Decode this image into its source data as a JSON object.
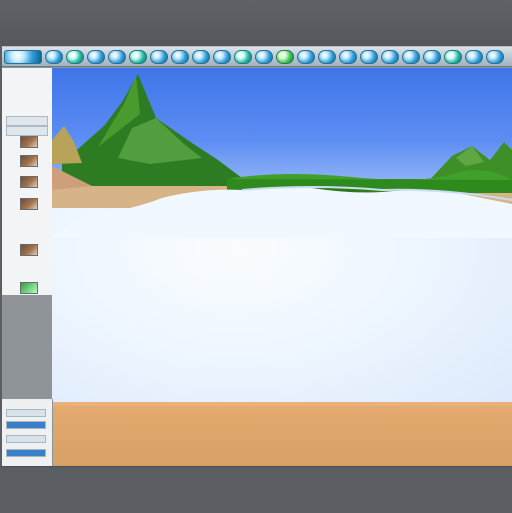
{
  "app": {
    "theme": {
      "window": "#8f9499",
      "toolbar": "#c8d6e0",
      "sky": "#3e75e8"
    }
  },
  "toolbar": {
    "buttons": [
      {
        "name": "dots-menu-icon"
      },
      {
        "name": "globe-icon"
      },
      {
        "name": "globe-icon"
      },
      {
        "name": "globe-icon"
      },
      {
        "name": "globe-icon"
      },
      {
        "name": "globe-icon"
      },
      {
        "name": "globe-icon"
      },
      {
        "name": "globe-icon"
      },
      {
        "name": "globe-icon"
      },
      {
        "name": "globe-icon"
      },
      {
        "name": "globe-icon"
      },
      {
        "name": "globe-icon"
      },
      {
        "name": "globe-icon"
      },
      {
        "name": "globe-icon"
      },
      {
        "name": "globe-icon"
      },
      {
        "name": "globe-icon"
      },
      {
        "name": "globe-icon"
      },
      {
        "name": "globe-icon"
      },
      {
        "name": "globe-icon"
      },
      {
        "name": "globe-icon"
      },
      {
        "name": "globe-icon"
      },
      {
        "name": "globe-icon"
      },
      {
        "name": "globe-icon"
      }
    ]
  },
  "sidebar": {
    "items": [
      {
        "name": "layer-thumbnail"
      },
      {
        "name": "layer-thumbnail"
      },
      {
        "name": "layer-thumbnail"
      },
      {
        "name": "layer-thumbnail"
      },
      {
        "name": "layer-thumbnail"
      },
      {
        "name": "layer-thumbnail"
      }
    ]
  },
  "scene": {
    "type": "3d-landscape",
    "elements": [
      "mountain",
      "sand-bank",
      "snow-field",
      "tree-line",
      "floor-plane"
    ]
  }
}
